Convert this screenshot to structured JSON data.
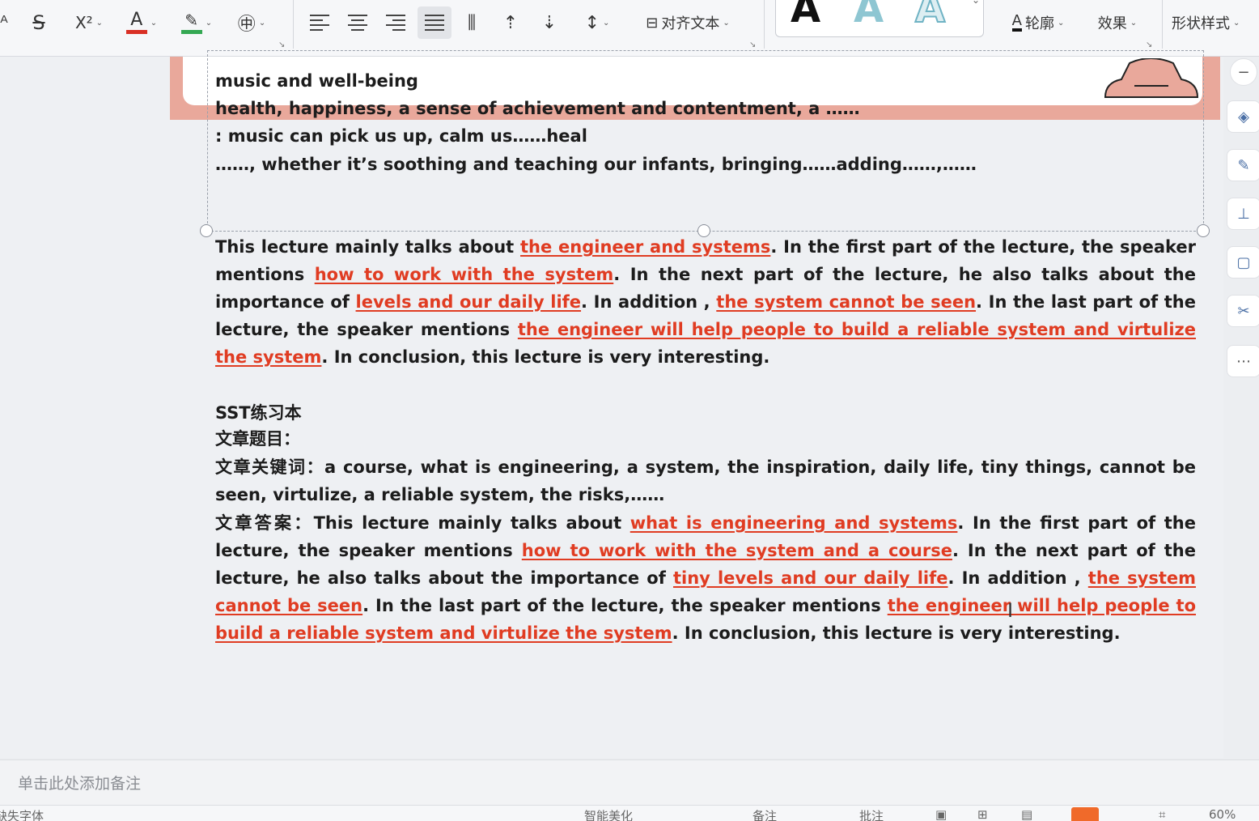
{
  "toolbar": {
    "strike_icon": "strikethrough-icon",
    "superscript_label": "X²",
    "font_color": "#d93025",
    "highlight_color": "#34a853",
    "phonetic_label": "㊥",
    "align_text_label": "对齐文本",
    "outline_label": "轮廓",
    "effect_label": "效果",
    "shape_style_label": "形状样式"
  },
  "slide": {
    "intro_lines": [
      "music and well-being",
      "health, happiness, a sense of achievement and contentment, a ……",
      ": music can pick us up, calm us……heal",
      "……, whether it’s soothing and teaching our infants, bringing……adding……,……"
    ],
    "para1": {
      "s1": "This lecture mainly talks about ",
      "h1": "the engineer and systems",
      "s2": ". In the first part of the lecture, the speaker mentions ",
      "h2": "how to work with the system",
      "s3": ". In the next part of the lecture, he also talks about the importance of ",
      "h3": "levels and our daily life",
      "s4": ". In addition , ",
      "h4": "the system cannot be seen",
      "s5": ". In the last part of the lecture, the speaker mentions ",
      "h5": "the engineer will help people to build a reliable system and virtulize the system",
      "s6": ". In conclusion, this lecture is very interesting."
    },
    "sst_title": "SST练习本",
    "article_title_label": "文章题目：",
    "keywords_label": "文章关键词：",
    "keywords": "a course, what is engineering, a system, the inspiration, daily life, tiny things, cannot be seen, virtulize, a reliable system, the risks,……",
    "answer_label": "文章答案：",
    "para2": {
      "s1": "This lecture mainly talks about ",
      "h1": "what is  engineering and systems",
      "s2": ". In the first part of the lecture, the speaker mentions ",
      "h2": "how to work with the system and a course",
      "s3": ". In the next part of the lecture, he also talks about the importance of ",
      "h3": "tiny levels and our daily life",
      "s4": ". In addition , ",
      "h4": "the system cannot be seen",
      "s5": ". In the last part of the lecture, the speaker mentions ",
      "h5": "the engineer will help people to build a reliable system and virtulize the system",
      "s6": ". In conclusion, this lecture is very interesting."
    }
  },
  "notes": {
    "placeholder": "单击此处添加备注"
  },
  "status": {
    "font_missing": "缺失字体",
    "smart_beautify": "智能美化",
    "notes_toggle": "备注",
    "comments": "批注",
    "zoom": "60%"
  }
}
